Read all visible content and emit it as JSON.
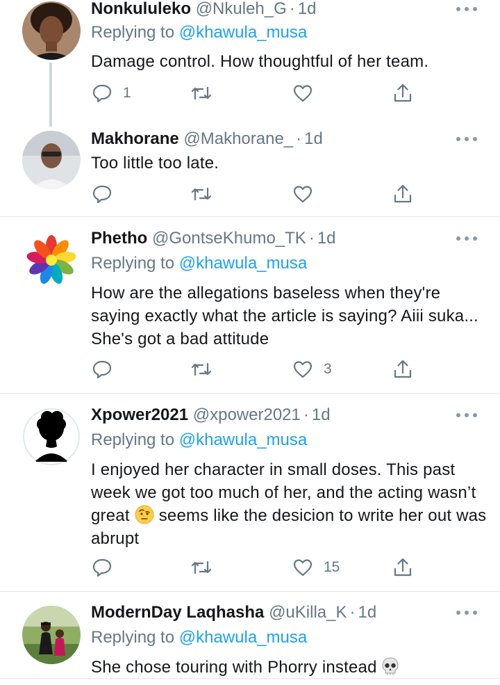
{
  "reply_prefix": "Replying to",
  "tweets": [
    {
      "display_name": "Nonkululeko",
      "handle": "@Nkuleh_G",
      "time": "1d",
      "replying_to": "@khawula_musa",
      "text": "Damage control. How thoughtful of her team.",
      "reply_count": "1",
      "like_count": ""
    },
    {
      "display_name": "Makhorane",
      "handle": "@Makhorane_",
      "time": "1d",
      "text": "Too little too late.",
      "reply_count": "",
      "like_count": ""
    },
    {
      "display_name": "Phetho",
      "handle": "@GontseKhumo_TK",
      "time": "1d",
      "replying_to": "@khawula_musa",
      "text": "How are the allegations baseless when they're saying exactly what the article is saying? Aiii suka... She's got a bad attitude",
      "reply_count": "",
      "like_count": "3"
    },
    {
      "display_name": "Xpower2021",
      "handle": "@xpower2021",
      "time": "1d",
      "replying_to": "@khawula_musa",
      "text_before_emoji": "I enjoyed her character in small doses. This past week we got too much of her, and the acting wasn’t great",
      "emoji_icon": "face-with-raised-eyebrow-emoji",
      "text_after_emoji": "seems like the desicion to write her out was abrupt",
      "reply_count": "",
      "like_count": "15"
    },
    {
      "display_name": "ModernDay Laqhasha",
      "handle": "@uKilla_K",
      "time": "1d",
      "replying_to": "@khawula_musa",
      "text": "She chose touring with Phorry instead",
      "emoji_icon": "skull-emoji",
      "reply_count": "",
      "like_count": ""
    }
  ],
  "colors": {
    "link": "#1da1f2",
    "secondary_text": "#657786",
    "primary_text": "#14171a",
    "divider": "#e1e8ed",
    "thread_line": "#ccd6dd"
  }
}
